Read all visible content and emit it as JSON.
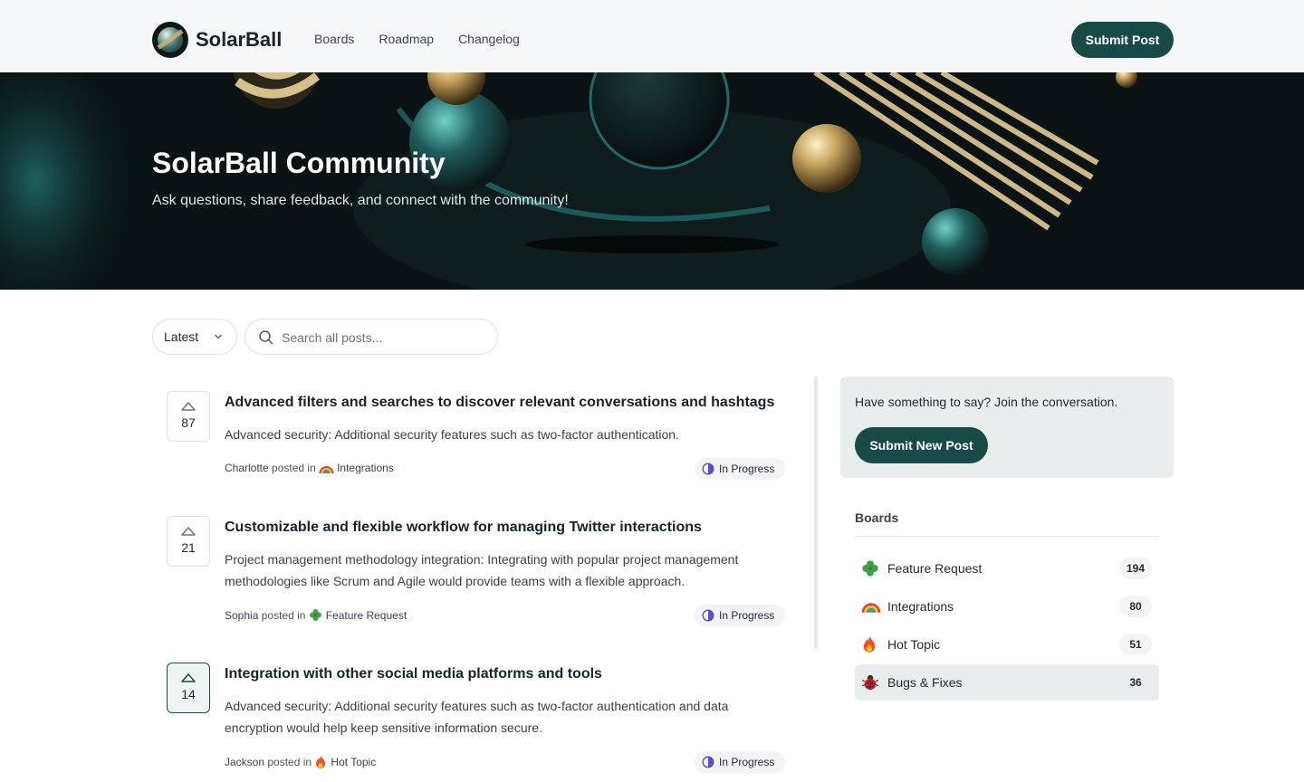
{
  "brand": {
    "name": "SolarBall"
  },
  "nav": {
    "items": [
      "Boards",
      "Roadmap",
      "Changelog"
    ]
  },
  "header": {
    "submit_label": "Submit Post"
  },
  "hero": {
    "title": "SolarBall Community",
    "subtitle": "Ask questions, share feedback, and connect with the community!"
  },
  "toolbar": {
    "sort_label": "Latest",
    "search_placeholder": "Search all posts...",
    "search_value": ""
  },
  "posts": [
    {
      "votes": "87",
      "title": "Advanced filters and searches to discover relevant conversations and hashtags",
      "body": "Advanced security: Additional security features such as two-factor authentication.",
      "author": "Charlotte",
      "posted_in": "posted in",
      "board": "Integrations",
      "board_icon": "rainbow-icon",
      "status": "In Progress",
      "voted": false
    },
    {
      "votes": "21",
      "title": "Customizable and flexible workflow for managing Twitter interactions",
      "body": "Project management methodology integration: Integrating with popular project management methodologies like Scrum and Agile would provide teams with a flexible approach.",
      "author": "Sophia",
      "posted_in": "posted in",
      "board": "Feature Request",
      "board_icon": "clover-icon",
      "status": "In Progress",
      "voted": false
    },
    {
      "votes": "14",
      "title": "Integration with other social media platforms and tools",
      "body": "Advanced security: Additional security features such as two-factor authentication and data encryption would help keep sensitive information secure.",
      "author": "Jackson",
      "posted_in": "posted in",
      "board": "Hot Topic",
      "board_icon": "fire-icon",
      "status": "In Progress",
      "voted": true
    }
  ],
  "sidebar": {
    "cta_text": "Have something to say? Join the conversation.",
    "cta_button": "Submit New Post",
    "boards_title": "Boards",
    "boards": [
      {
        "name": "Feature Request",
        "count": "194",
        "icon": "clover-icon",
        "active": false
      },
      {
        "name": "Integrations",
        "count": "80",
        "icon": "rainbow-icon",
        "active": false
      },
      {
        "name": "Hot Topic",
        "count": "51",
        "icon": "fire-icon",
        "active": false
      },
      {
        "name": "Bugs & Fixes",
        "count": "36",
        "icon": "ladybug-icon",
        "active": true
      }
    ]
  },
  "colors": {
    "accent": "#184a48",
    "header_bg": "#f6f7f9",
    "hero_bg": "#0a1213",
    "cta_bg": "#e8eeed",
    "status_icon": "#5b4fc8"
  }
}
